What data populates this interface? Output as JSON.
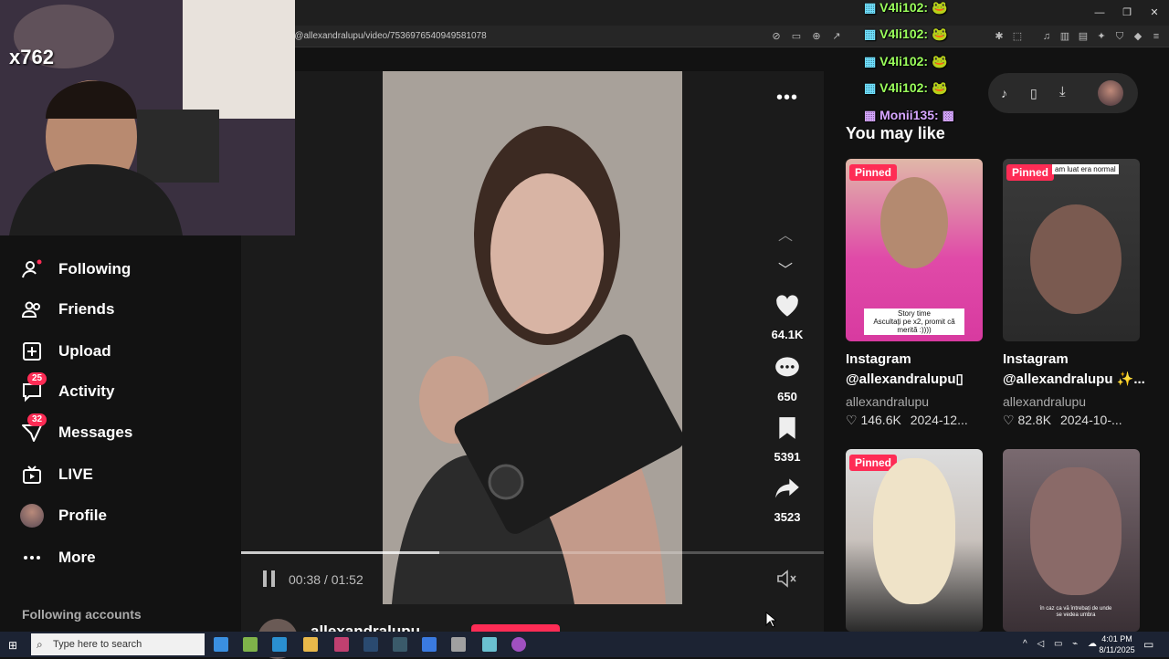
{
  "browser": {
    "url": "n/@allexandralupu/video/7536976540949581078",
    "window_controls": {
      "minimize": "—",
      "restore": "❐",
      "close": "✕"
    }
  },
  "sidebar": {
    "items": [
      {
        "label": "Following",
        "icon": "following-icon",
        "badge": ""
      },
      {
        "label": "Friends",
        "icon": "friends-icon",
        "badge": ""
      },
      {
        "label": "Upload",
        "icon": "upload-icon",
        "badge": ""
      },
      {
        "label": "Activity",
        "icon": "activity-icon",
        "badge": "25"
      },
      {
        "label": "Messages",
        "icon": "messages-icon",
        "badge": "32"
      },
      {
        "label": "LIVE",
        "icon": "live-icon",
        "badge": ""
      },
      {
        "label": "Profile",
        "icon": "avatar",
        "badge": ""
      },
      {
        "label": "More",
        "icon": "more-icon",
        "badge": ""
      }
    ],
    "following_accounts": "Following accounts"
  },
  "video": {
    "time": "00:38 / 01:52",
    "progress": 0.34,
    "author_partial": "allexandralupu",
    "actions": {
      "likes": "64.1K",
      "comments": "650",
      "saves": "5391",
      "shares": "3523"
    }
  },
  "recommend": {
    "heading": "You may like",
    "cards": [
      {
        "pinned": "Pinned",
        "title_line1": "Instagram",
        "title_line2": "@allexandralupu▯",
        "author": "allexandralupu",
        "likes": "146.6K",
        "date": "2024-12...",
        "overlay": "Story time\nAscultați pe x2, promit că merită :))))"
      },
      {
        "pinned": "Pinned",
        "title_line1": "Instagram",
        "title_line2": "@allexandralupu ✨...",
        "author": "allexandralupu",
        "likes": "82.8K",
        "date": "2024-10-...",
        "overlay": "am luat era normal"
      },
      {
        "pinned": "Pinned",
        "overlay": ""
      },
      {
        "pinned": "",
        "overlay": "în caz ca vă întrebați de unde se vedea umbra"
      }
    ]
  },
  "chat": [
    {
      "user": "V4li102:",
      "style": "green"
    },
    {
      "user": "V4li102:",
      "style": "green"
    },
    {
      "user": "V4li102:",
      "style": "green"
    },
    {
      "user": "V4li102:",
      "style": "green"
    },
    {
      "user": "Monii135:",
      "style": "pink"
    }
  ],
  "webcam": {
    "counter": "x762"
  },
  "taskbar": {
    "search_placeholder": "Type here to search",
    "time": "4:01 PM",
    "date": "8/11/2025"
  },
  "colors": {
    "accent": "#fe2c55",
    "chat_green": "#9bff5c",
    "background": "#121212"
  }
}
